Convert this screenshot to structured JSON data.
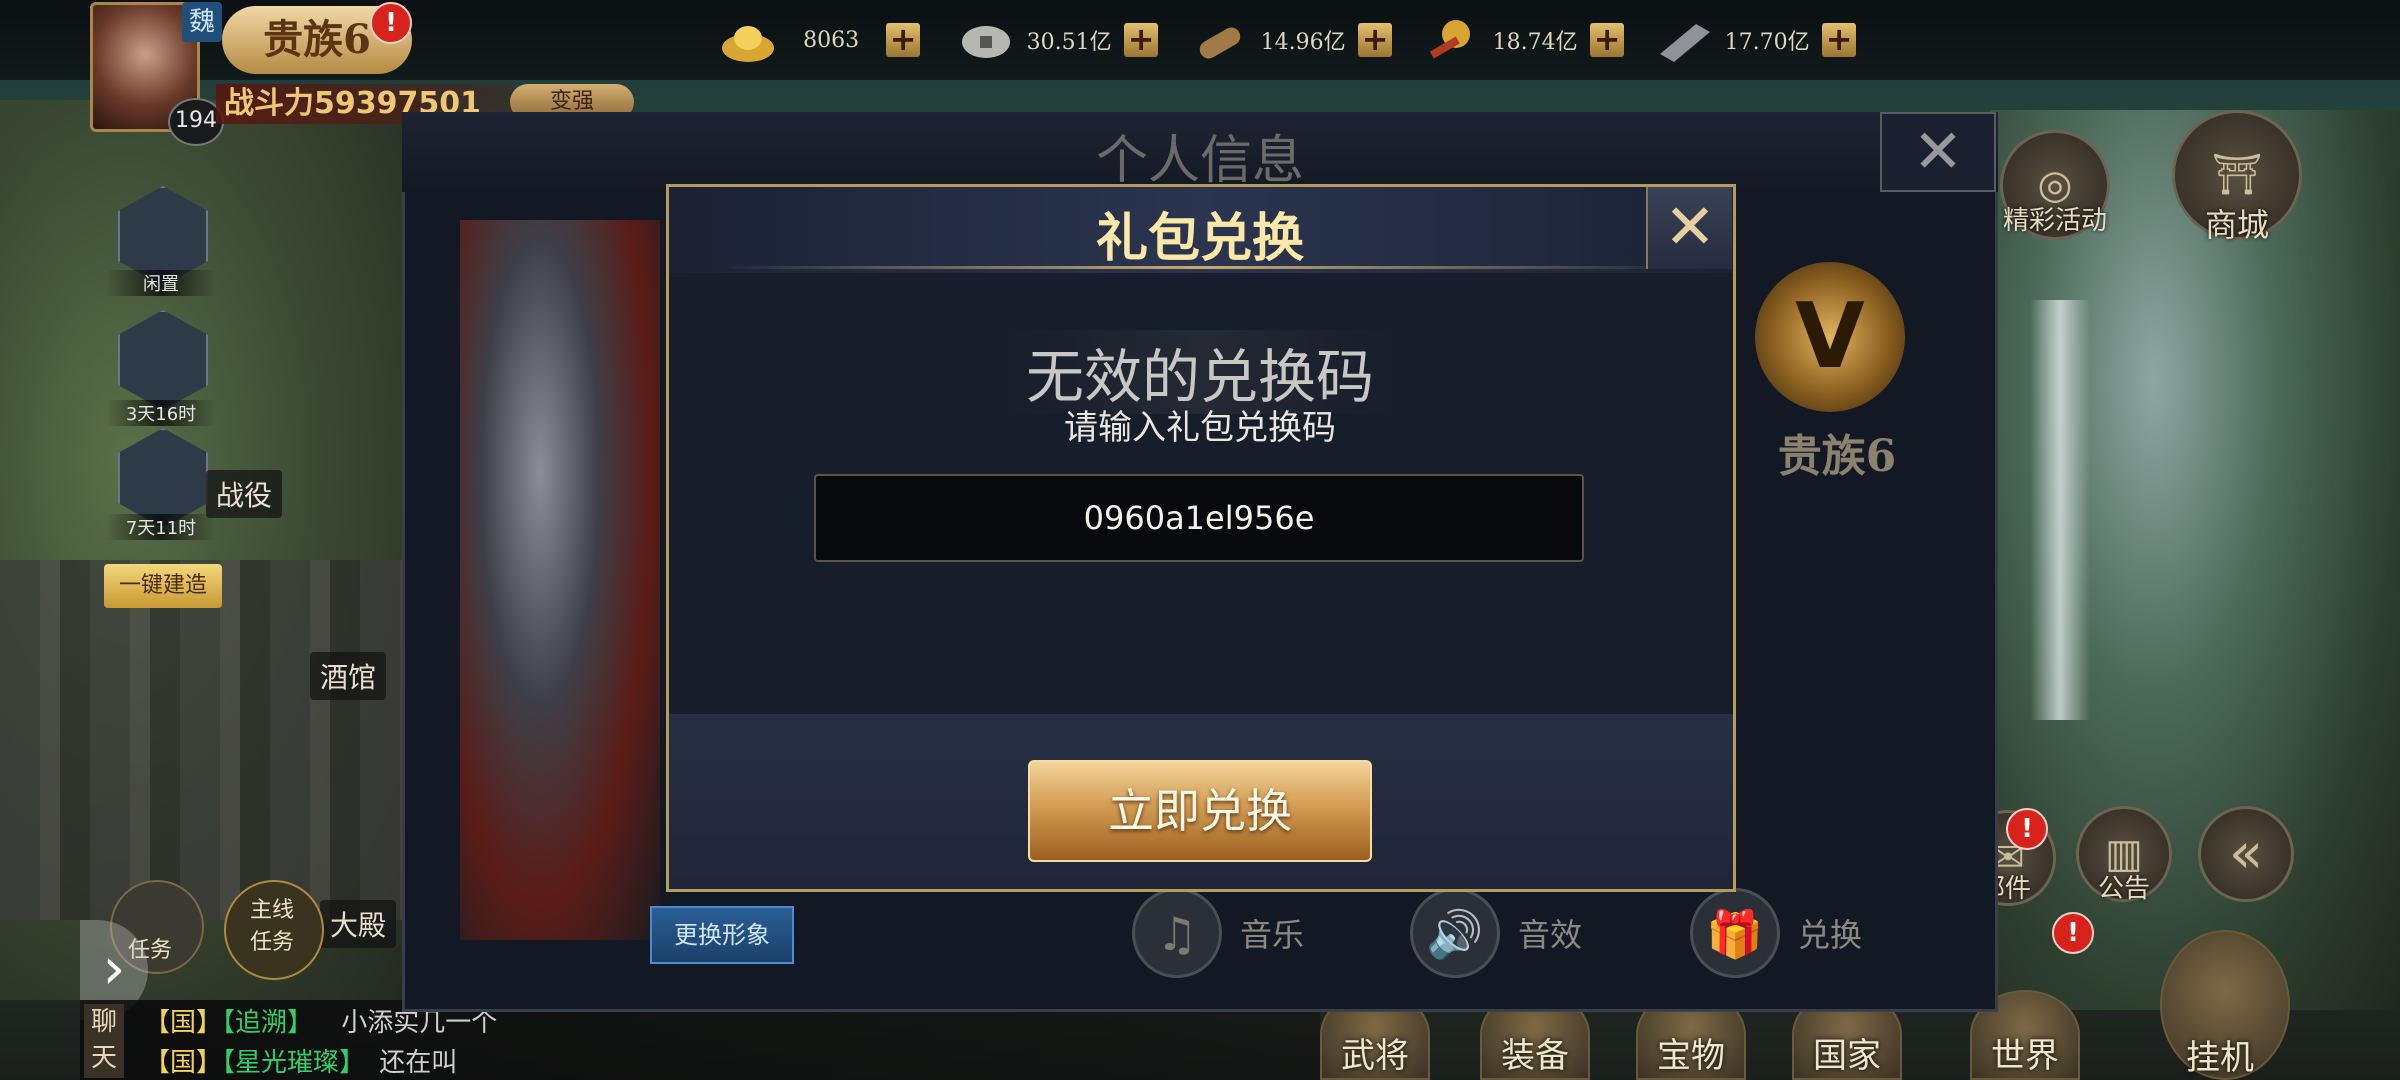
{
  "player": {
    "faction": "魏",
    "level": "194",
    "noble_rank": "贵族6",
    "power_label": "战斗力59397501",
    "change_label": "变强",
    "noble_alert": "!"
  },
  "resources": [
    {
      "icon": "gold-ingot-icon",
      "value": "8063"
    },
    {
      "icon": "coin-icon",
      "value": "30.51亿"
    },
    {
      "icon": "wood-icon",
      "value": "14.96亿"
    },
    {
      "icon": "grain-icon",
      "value": "18.74亿"
    },
    {
      "icon": "iron-icon",
      "value": "17.70亿"
    }
  ],
  "left_panel": {
    "idle_label": "闲置",
    "timer1": "3天16时",
    "timer2": "7天11时",
    "build_all": "一键建造",
    "task_label": "任务",
    "main_task_label": "主线任务",
    "battle_label": "战役",
    "tavern_label": "酒馆",
    "palace_label": "大殿"
  },
  "chat": {
    "tag": "聊天",
    "lines": [
      {
        "channel": "【国】",
        "name": "【追溯】",
        "msg": "小添实几一个"
      },
      {
        "channel": "【国】",
        "name": "【星光璀璨】",
        "msg": "还在叫"
      }
    ]
  },
  "panel": {
    "title": "个人信息",
    "noble_text": "贵族6",
    "noble_symbol": "V",
    "swap_look": "更换形象",
    "settings": [
      {
        "icon": "music-icon",
        "glyph": "♫",
        "label": "音乐"
      },
      {
        "icon": "sound-icon",
        "glyph": "🔊",
        "label": "音效"
      },
      {
        "icon": "gift-icon",
        "glyph": "🎁",
        "label": "兑换"
      }
    ]
  },
  "dialog": {
    "title": "礼包兑换",
    "error": "无效的兑换码",
    "prompt": "请输入礼包兑换码",
    "code": "0960a1el956e",
    "redeem_button": "立即兑换"
  },
  "right_menu": {
    "events_label": "精彩活动",
    "shop_label": "商城",
    "mail_label": "邮件",
    "notice_label": "公告",
    "alert": "!"
  },
  "bottom_nav": [
    {
      "label": "武将"
    },
    {
      "label": "装备"
    },
    {
      "label": "宝物"
    },
    {
      "label": "国家"
    },
    {
      "label": "世界"
    },
    {
      "label": "挂机"
    }
  ],
  "colors": {
    "accent_gold": "#c8aa6e",
    "dialog_title": "#fbe7a6",
    "alert_red": "#d8221c",
    "chat_channel": "#f2d35a",
    "chat_name": "#2fd06a"
  }
}
